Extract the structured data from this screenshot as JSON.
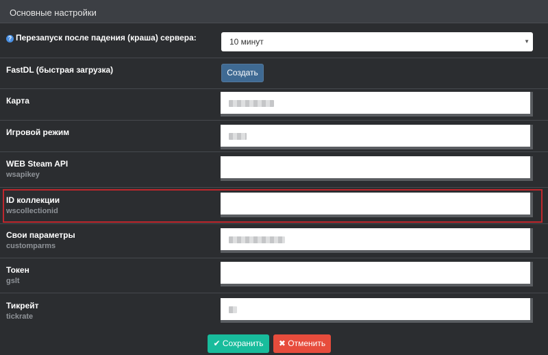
{
  "panel": {
    "title": "Основные настройки"
  },
  "rows": {
    "restart": {
      "label": "Перезапуск после падения (краша) сервера:",
      "select_value": "10 минут"
    },
    "fastdl": {
      "label": "FastDL (быстрая загрузка)",
      "button": "Создать"
    },
    "map": {
      "label": "Карта"
    },
    "gamemode": {
      "label": "Игровой режим"
    },
    "webapi": {
      "label": "WEB Steam API",
      "sublabel": "wsapikey"
    },
    "collection": {
      "label": "ID коллекции",
      "sublabel": "wscollectionid"
    },
    "customparms": {
      "label": "Свои параметры",
      "sublabel": "customparms"
    },
    "token": {
      "label": "Токен",
      "sublabel": "gslt"
    },
    "tickrate": {
      "label": "Тикрейт",
      "sublabel": "tickrate"
    }
  },
  "footer": {
    "save_label": "Сохранить",
    "cancel_label": "Отменить"
  },
  "icons": {
    "help": "question-circle-icon",
    "save": "check-icon",
    "cancel": "times-icon",
    "caret": "caret-down-icon"
  },
  "colors": {
    "save": "#18bc9c",
    "cancel": "#e74c3c",
    "create": "#3f6a93",
    "highlight": "#c0272d"
  }
}
